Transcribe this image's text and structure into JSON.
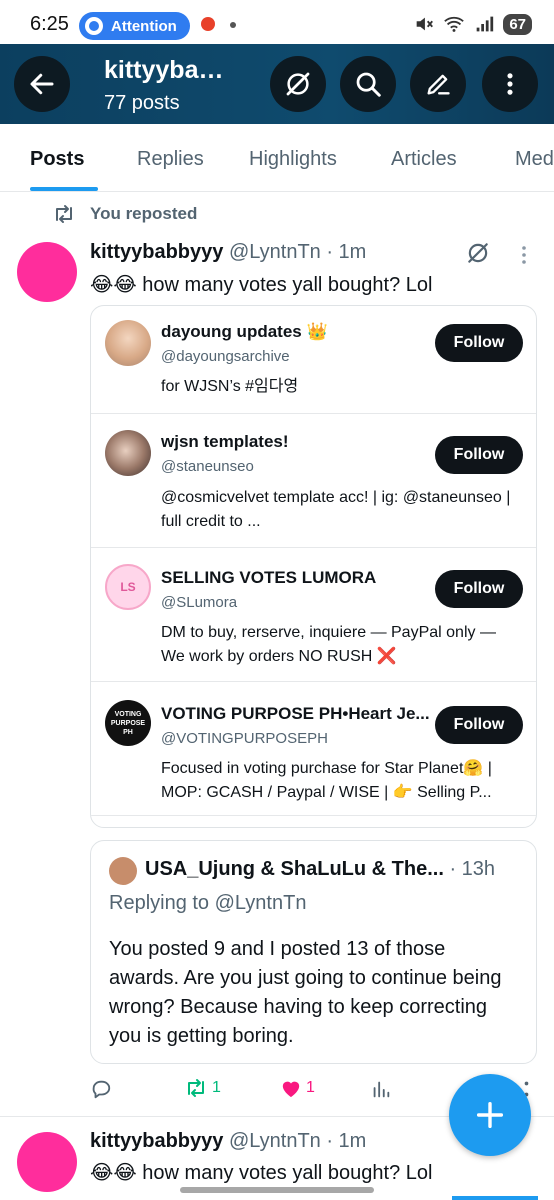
{
  "status_bar": {
    "time": "6:25",
    "attention_label": "Attention",
    "battery": "67"
  },
  "header": {
    "title": "kittyyba…",
    "subtitle": "77 posts"
  },
  "tabs": [
    "Posts",
    "Replies",
    "Highlights",
    "Articles",
    "Med"
  ],
  "active_tab": "Posts",
  "repost_label": "You reposted",
  "tweet": {
    "name": "kittyybabbyyy",
    "handle_time": "@LyntnTn · 1m",
    "text": "😂😂 how many votes yall bought? Lol"
  },
  "accounts": [
    {
      "name": "dayoung updates 👑",
      "handle": "@dayoungsarchive",
      "bio": "for WJSN’s #임다영",
      "follow": "Follow"
    },
    {
      "name": "wjsn templates!",
      "handle": "@staneunseo",
      "bio": "@cosmicvelvet template acc! | ig: @staneunseo | full credit to ...",
      "follow": "Follow"
    },
    {
      "name": "SELLING VOTES LUMORA",
      "handle": "@SLumora",
      "bio": "DM to buy, rerserve, inquiere — PayPal only — We work by orders NO RUSH ❌",
      "follow": "Follow"
    },
    {
      "name": "VOTING PURPOSE PH•Heart Je...",
      "handle": "@VOTINGPURPOSEPH",
      "bio": "Focused in voting purchase for Star Planet🤗 | MOP: GCASH / Paypal / WISE | 👉 Selling P...",
      "follow": "Follow",
      "avatar_text": "VOTING PURPOSE PH"
    }
  ],
  "quote": {
    "name": "USA_Ujung & ShaLuLu & The...",
    "time": "· 13h",
    "replying": "Replying to @LyntnTn",
    "text": "You posted 9 and I posted 13 of those awards.  Are you just going to continue being wrong? Because having to keep correcting you is getting boring."
  },
  "actions": {
    "reposts": "1",
    "likes": "1",
    "like_color": "#f91880",
    "repost_color": "#00ba7c"
  },
  "next_tweet": {
    "name": "kittyybabbyyy",
    "handle_time": "@LyntnTn · 1m",
    "text": "😂😂 how many votes yall bought? Lol"
  },
  "colors": {
    "accent": "#1d9bf0",
    "header_bg": "#0f4b6e",
    "avatar_pink": "#ff2d9c"
  },
  "icons": [
    "back-arrow-icon",
    "grok-icon",
    "search-icon",
    "compose-icon",
    "more-vertical-icon",
    "repost-icon",
    "reply-icon",
    "heart-icon",
    "views-icon",
    "share-icon",
    "plus-icon"
  ]
}
